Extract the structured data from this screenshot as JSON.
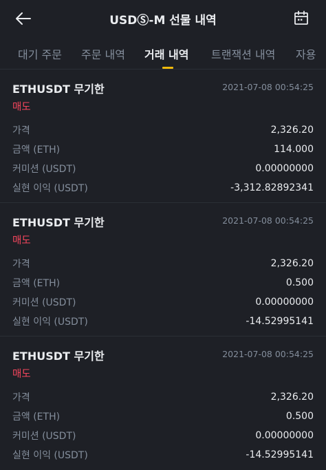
{
  "header": {
    "title": "USDⓈ-M 선물 내역",
    "back_icon": "arrow-left-icon",
    "calendar_icon": "calendar-icon"
  },
  "tabs": [
    {
      "label": "대기 주문",
      "active": false
    },
    {
      "label": "주문 내역",
      "active": false
    },
    {
      "label": "거래 내역",
      "active": true
    },
    {
      "label": "트랜잭션 내역",
      "active": false
    },
    {
      "label": "자용",
      "active": false
    }
  ],
  "trades": [
    {
      "symbol": "ETHUSDT 무기한",
      "time": "2021-07-08 00:54:25",
      "side": "매도",
      "rows": [
        {
          "label": "가격",
          "value": "2,326.20"
        },
        {
          "label": "금액 (ETH)",
          "value": "114.000"
        },
        {
          "label": "커미션 (USDT)",
          "value": "0.00000000"
        },
        {
          "label": "실현 이익 (USDT)",
          "value": "-3,312.82892341"
        }
      ]
    },
    {
      "symbol": "ETHUSDT 무기한",
      "time": "2021-07-08 00:54:25",
      "side": "매도",
      "rows": [
        {
          "label": "가격",
          "value": "2,326.20"
        },
        {
          "label": "금액 (ETH)",
          "value": "0.500"
        },
        {
          "label": "커미션 (USDT)",
          "value": "0.00000000"
        },
        {
          "label": "실현 이익 (USDT)",
          "value": "-14.52995141"
        }
      ]
    },
    {
      "symbol": "ETHUSDT 무기한",
      "time": "2021-07-08 00:54:25",
      "side": "매도",
      "rows": [
        {
          "label": "가격",
          "value": "2,326.20"
        },
        {
          "label": "금액 (ETH)",
          "value": "0.500"
        },
        {
          "label": "커미션 (USDT)",
          "value": "0.00000000"
        },
        {
          "label": "실현 이익 (USDT)",
          "value": "-14.52995141"
        }
      ]
    }
  ],
  "colors": {
    "background": "#1e2026",
    "accent": "#f0b90b",
    "sell": "#f6465d",
    "muted": "#848e9c",
    "text": "#eaecef"
  }
}
